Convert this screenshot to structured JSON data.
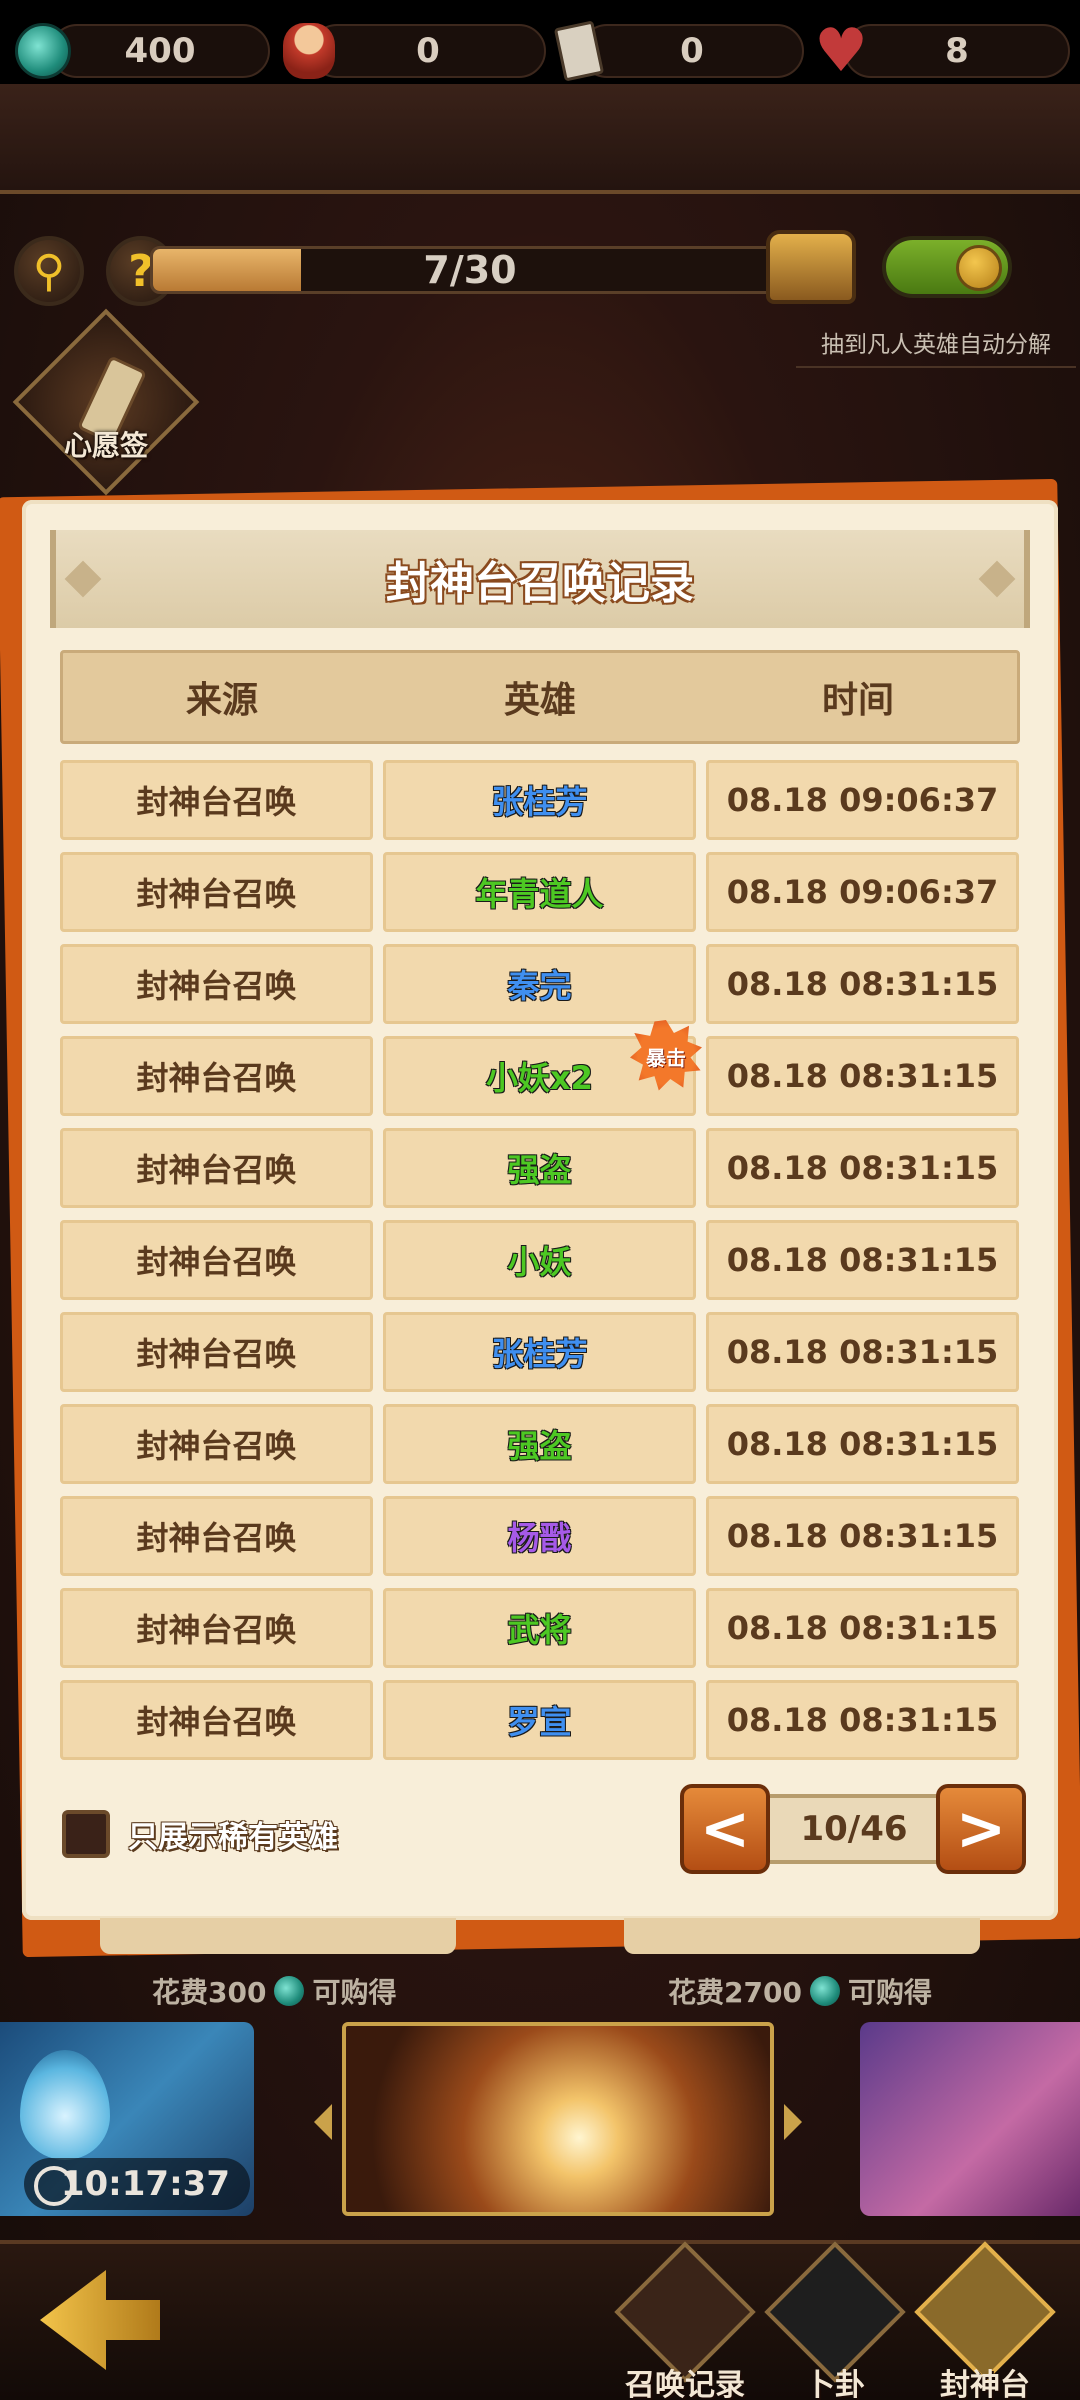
{
  "resources": [
    {
      "icon": "jade-coin-icon",
      "value": "400"
    },
    {
      "icon": "lucky-doll-icon",
      "value": "0"
    },
    {
      "icon": "ticket-icon",
      "value": "0"
    },
    {
      "icon": "heart-icon",
      "value": "8"
    }
  ],
  "summon_progress": {
    "current": 7,
    "total": 30,
    "text": "7/30",
    "fraction": 0.233
  },
  "auto_decompose": {
    "label": "抽到凡人英雄自动分解",
    "enabled": true
  },
  "wish": {
    "label": "心愿签"
  },
  "dialog": {
    "title": "封神台召唤记录",
    "columns": [
      "来源",
      "英雄",
      "时间"
    ],
    "rows": [
      {
        "source": "封神台召唤",
        "hero": "张桂芳",
        "hero_color": "#3f8ff0",
        "time": "08.18 09:06:37",
        "crit": ""
      },
      {
        "source": "封神台召唤",
        "hero": "年青道人",
        "hero_color": "#4dc823",
        "time": "08.18 09:06:37",
        "crit": ""
      },
      {
        "source": "封神台召唤",
        "hero": "秦完",
        "hero_color": "#3f8ff0",
        "time": "08.18 08:31:15",
        "crit": ""
      },
      {
        "source": "封神台召唤",
        "hero": "小妖x2",
        "hero_color": "#4dc823",
        "time": "08.18 08:31:15",
        "crit": "暴击"
      },
      {
        "source": "封神台召唤",
        "hero": "强盗",
        "hero_color": "#4dc823",
        "time": "08.18 08:31:15",
        "crit": ""
      },
      {
        "source": "封神台召唤",
        "hero": "小妖",
        "hero_color": "#4dc823",
        "time": "08.18 08:31:15",
        "crit": ""
      },
      {
        "source": "封神台召唤",
        "hero": "张桂芳",
        "hero_color": "#3f8ff0",
        "time": "08.18 08:31:15",
        "crit": ""
      },
      {
        "source": "封神台召唤",
        "hero": "强盗",
        "hero_color": "#4dc823",
        "time": "08.18 08:31:15",
        "crit": ""
      },
      {
        "source": "封神台召唤",
        "hero": "杨戬",
        "hero_color": "#a65ae8",
        "time": "08.18 08:31:15",
        "crit": ""
      },
      {
        "source": "封神台召唤",
        "hero": "武将",
        "hero_color": "#4dc823",
        "time": "08.18 08:31:15",
        "crit": ""
      },
      {
        "source": "封神台召唤",
        "hero": "罗宣",
        "hero_color": "#3f8ff0",
        "time": "08.18 08:31:15",
        "crit": ""
      }
    ],
    "filter_label": "只展示稀有英雄",
    "filter_checked": false,
    "pagination": {
      "prev": "<",
      "page": "10/46",
      "next": ">"
    }
  },
  "shop": {
    "left_cost": "花费300",
    "right_cost": "花费2700",
    "buy_label": "可购得"
  },
  "banners": {
    "timer": "10:17:37"
  },
  "bottom_nav": [
    {
      "icon": "record-scroll-icon",
      "label": "召唤记录"
    },
    {
      "icon": "yin-yang-icon",
      "label": "卜卦"
    },
    {
      "icon": "altar-scroll-icon",
      "label": "封神台"
    }
  ]
}
